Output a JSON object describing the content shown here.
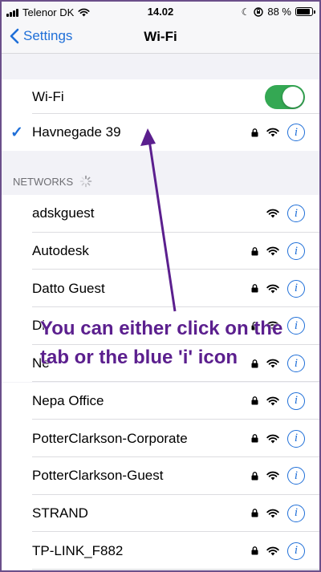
{
  "status_bar": {
    "carrier": "Telenor DK",
    "time": "14.02",
    "battery_percent": "88 %",
    "battery_level": 0.88
  },
  "nav": {
    "back_label": "Settings",
    "title": "Wi-Fi"
  },
  "wifi_toggle": {
    "label": "Wi-Fi",
    "on": true,
    "color": "#34a853"
  },
  "connected": {
    "name": "Havnegade 39",
    "locked": true
  },
  "networks_header": "NETWORKS",
  "networks": [
    {
      "name": "adskguest",
      "locked": false
    },
    {
      "name": "Autodesk",
      "locked": true
    },
    {
      "name": "Datto Guest",
      "locked": true
    },
    {
      "name": "Di",
      "locked": true
    },
    {
      "name": "Ne",
      "locked": true
    },
    {
      "name": "Nepa Office",
      "locked": true
    },
    {
      "name": "PotterClarkson-Corporate",
      "locked": true
    },
    {
      "name": "PotterClarkson-Guest",
      "locked": true
    },
    {
      "name": "STRAND",
      "locked": true
    },
    {
      "name": "TP-LINK_F882",
      "locked": true
    }
  ],
  "annotation": {
    "text": "You can either click on the tab or the blue 'i' icon",
    "color": "#5b1f8e"
  },
  "accent_color": "#1f6fd8",
  "icons": {
    "back": "chevron-left-icon",
    "check": "checkmark-icon",
    "lock": "lock-icon",
    "wifi": "wifi-icon",
    "info": "info-icon",
    "spinner": "loading-spinner-icon"
  }
}
